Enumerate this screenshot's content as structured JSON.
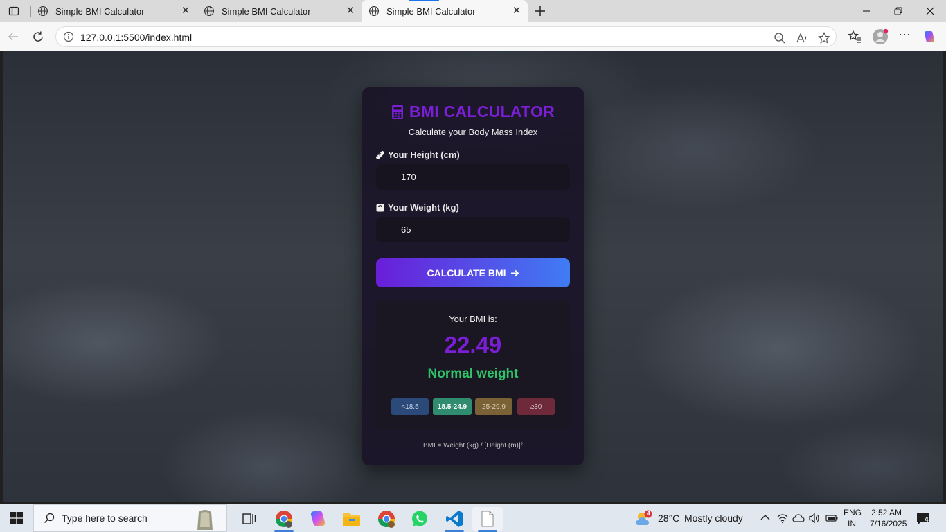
{
  "browser": {
    "tabs": [
      {
        "title": "Simple BMI Calculator",
        "active": false
      },
      {
        "title": "Simple BMI Calculator",
        "active": false
      },
      {
        "title": "Simple BMI Calculator",
        "active": true
      }
    ],
    "url": "127.0.0.1:5500/index.html"
  },
  "page": {
    "title": "BMI CALCULATOR",
    "subtitle": "Calculate your Body Mass Index",
    "height_label": "Your Height (cm)",
    "height_value": "170",
    "weight_label": "Your Weight (kg)",
    "weight_value": "65",
    "button_label": "CALCULATE BMI",
    "result_label": "Your BMI is:",
    "bmi_value": "22.49",
    "bmi_category": "Normal weight",
    "ranges": [
      {
        "label": "<18.5",
        "color": "#2b4a7a"
      },
      {
        "label": "18.5-24.9",
        "color": "#2f8c6f"
      },
      {
        "label": "25-29.9",
        "color": "#7a6236"
      },
      {
        "label": "≥30",
        "color": "#6e2a3a"
      }
    ],
    "formula": "BMI = Weight (kg) / [Height (m)]²",
    "accent_color": "#7b1fd6",
    "category_color": "#2fc46a"
  },
  "taskbar": {
    "search_placeholder": "Type here to search",
    "weather_temp": "28°C",
    "weather_text": "Mostly cloudy",
    "weather_badge": "4",
    "lang_top": "ENG",
    "lang_bottom": "IN",
    "time": "2:52 AM",
    "date": "7/16/2025",
    "notification_count": "4"
  }
}
